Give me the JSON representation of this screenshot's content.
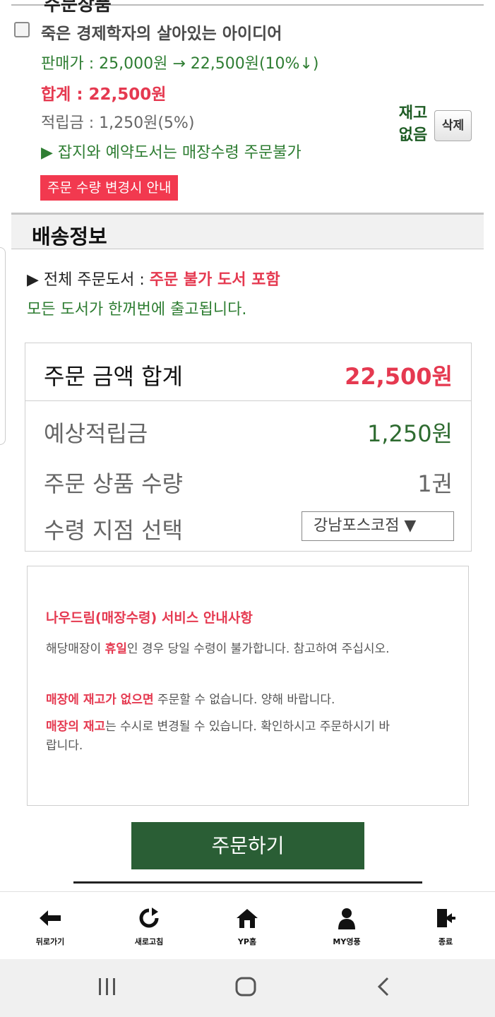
{
  "prev_section": {
    "title": "주문상품"
  },
  "item": {
    "title": "죽은 경제학자의 살아있는 아이디어",
    "price_line": "판매가 : 25,000원 → 22,500원(10%↓)",
    "total_line": "합계 : 22,500원",
    "point_line": "적립금 : 1,250원(5%)",
    "notice_line": "▶ 잡지와 예약도서는 매장수령 주문불가",
    "qty_notice": "주문 수량 변경시 안내",
    "stock_line1": "재고",
    "stock_line2": "없음",
    "delete_label": "삭제"
  },
  "delivery": {
    "section_title": "배송정보",
    "line1_prefix": "▶ 전체 주문도서 : ",
    "line1_highlight": "주문 불가 도서 포함",
    "line2": "모든 도서가 한꺼번에 출고됩니다."
  },
  "summary": {
    "total_label": "주문 금액 합계",
    "total_value": "22,500원",
    "points_label": "예상적립금",
    "points_value": "1,250원",
    "qty_label": "주문 상품 수량",
    "qty_value": "1권",
    "branch_label": "수령 지점 선택",
    "branch_value": "강남포스코점 ▼"
  },
  "info": {
    "title": "나우드림(매장수령) 서비스 안내사항",
    "p1_a": "해당매장이 ",
    "p1_b": "휴일",
    "p1_c": "인 경우 당일 수령이 불가합니다. 참고하여 주십시오.",
    "p2_a": "매장에 재고가 없으면",
    "p2_b": " 주문할 수 없습니다. 양해 바랍니다.",
    "p3_a": "매장의 재고",
    "p3_b": "는 수시로 변경될 수 있습니다. 확인하시고 주문하시기 바랍니다."
  },
  "order_button": "주문하기",
  "bottom_nav": [
    {
      "label": "뒤로가기",
      "icon": "arrow-left-icon"
    },
    {
      "label": "새로고침",
      "icon": "refresh-icon"
    },
    {
      "label": "YP홈",
      "icon": "home-icon"
    },
    {
      "label": "MY영풍",
      "icon": "user-icon"
    },
    {
      "label": "종료",
      "icon": "exit-icon"
    }
  ],
  "colors": {
    "accent_red": "#e53950",
    "accent_green": "#2a5e35",
    "text_green": "#2e7d32"
  }
}
